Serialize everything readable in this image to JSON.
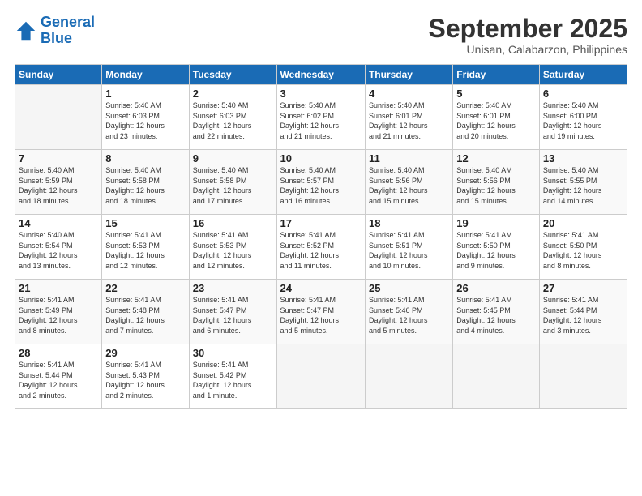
{
  "logo": {
    "line1": "General",
    "line2": "Blue"
  },
  "title": "September 2025",
  "subtitle": "Unisan, Calabarzon, Philippines",
  "days_of_week": [
    "Sunday",
    "Monday",
    "Tuesday",
    "Wednesday",
    "Thursday",
    "Friday",
    "Saturday"
  ],
  "weeks": [
    [
      {
        "day": "",
        "info": ""
      },
      {
        "day": "1",
        "info": "Sunrise: 5:40 AM\nSunset: 6:03 PM\nDaylight: 12 hours\nand 23 minutes."
      },
      {
        "day": "2",
        "info": "Sunrise: 5:40 AM\nSunset: 6:03 PM\nDaylight: 12 hours\nand 22 minutes."
      },
      {
        "day": "3",
        "info": "Sunrise: 5:40 AM\nSunset: 6:02 PM\nDaylight: 12 hours\nand 21 minutes."
      },
      {
        "day": "4",
        "info": "Sunrise: 5:40 AM\nSunset: 6:01 PM\nDaylight: 12 hours\nand 21 minutes."
      },
      {
        "day": "5",
        "info": "Sunrise: 5:40 AM\nSunset: 6:01 PM\nDaylight: 12 hours\nand 20 minutes."
      },
      {
        "day": "6",
        "info": "Sunrise: 5:40 AM\nSunset: 6:00 PM\nDaylight: 12 hours\nand 19 minutes."
      }
    ],
    [
      {
        "day": "7",
        "info": "Sunrise: 5:40 AM\nSunset: 5:59 PM\nDaylight: 12 hours\nand 18 minutes."
      },
      {
        "day": "8",
        "info": "Sunrise: 5:40 AM\nSunset: 5:58 PM\nDaylight: 12 hours\nand 18 minutes."
      },
      {
        "day": "9",
        "info": "Sunrise: 5:40 AM\nSunset: 5:58 PM\nDaylight: 12 hours\nand 17 minutes."
      },
      {
        "day": "10",
        "info": "Sunrise: 5:40 AM\nSunset: 5:57 PM\nDaylight: 12 hours\nand 16 minutes."
      },
      {
        "day": "11",
        "info": "Sunrise: 5:40 AM\nSunset: 5:56 PM\nDaylight: 12 hours\nand 15 minutes."
      },
      {
        "day": "12",
        "info": "Sunrise: 5:40 AM\nSunset: 5:56 PM\nDaylight: 12 hours\nand 15 minutes."
      },
      {
        "day": "13",
        "info": "Sunrise: 5:40 AM\nSunset: 5:55 PM\nDaylight: 12 hours\nand 14 minutes."
      }
    ],
    [
      {
        "day": "14",
        "info": "Sunrise: 5:40 AM\nSunset: 5:54 PM\nDaylight: 12 hours\nand 13 minutes."
      },
      {
        "day": "15",
        "info": "Sunrise: 5:41 AM\nSunset: 5:53 PM\nDaylight: 12 hours\nand 12 minutes."
      },
      {
        "day": "16",
        "info": "Sunrise: 5:41 AM\nSunset: 5:53 PM\nDaylight: 12 hours\nand 12 minutes."
      },
      {
        "day": "17",
        "info": "Sunrise: 5:41 AM\nSunset: 5:52 PM\nDaylight: 12 hours\nand 11 minutes."
      },
      {
        "day": "18",
        "info": "Sunrise: 5:41 AM\nSunset: 5:51 PM\nDaylight: 12 hours\nand 10 minutes."
      },
      {
        "day": "19",
        "info": "Sunrise: 5:41 AM\nSunset: 5:50 PM\nDaylight: 12 hours\nand 9 minutes."
      },
      {
        "day": "20",
        "info": "Sunrise: 5:41 AM\nSunset: 5:50 PM\nDaylight: 12 hours\nand 8 minutes."
      }
    ],
    [
      {
        "day": "21",
        "info": "Sunrise: 5:41 AM\nSunset: 5:49 PM\nDaylight: 12 hours\nand 8 minutes."
      },
      {
        "day": "22",
        "info": "Sunrise: 5:41 AM\nSunset: 5:48 PM\nDaylight: 12 hours\nand 7 minutes."
      },
      {
        "day": "23",
        "info": "Sunrise: 5:41 AM\nSunset: 5:47 PM\nDaylight: 12 hours\nand 6 minutes."
      },
      {
        "day": "24",
        "info": "Sunrise: 5:41 AM\nSunset: 5:47 PM\nDaylight: 12 hours\nand 5 minutes."
      },
      {
        "day": "25",
        "info": "Sunrise: 5:41 AM\nSunset: 5:46 PM\nDaylight: 12 hours\nand 5 minutes."
      },
      {
        "day": "26",
        "info": "Sunrise: 5:41 AM\nSunset: 5:45 PM\nDaylight: 12 hours\nand 4 minutes."
      },
      {
        "day": "27",
        "info": "Sunrise: 5:41 AM\nSunset: 5:44 PM\nDaylight: 12 hours\nand 3 minutes."
      }
    ],
    [
      {
        "day": "28",
        "info": "Sunrise: 5:41 AM\nSunset: 5:44 PM\nDaylight: 12 hours\nand 2 minutes."
      },
      {
        "day": "29",
        "info": "Sunrise: 5:41 AM\nSunset: 5:43 PM\nDaylight: 12 hours\nand 2 minutes."
      },
      {
        "day": "30",
        "info": "Sunrise: 5:41 AM\nSunset: 5:42 PM\nDaylight: 12 hours\nand 1 minute."
      },
      {
        "day": "",
        "info": ""
      },
      {
        "day": "",
        "info": ""
      },
      {
        "day": "",
        "info": ""
      },
      {
        "day": "",
        "info": ""
      }
    ]
  ]
}
